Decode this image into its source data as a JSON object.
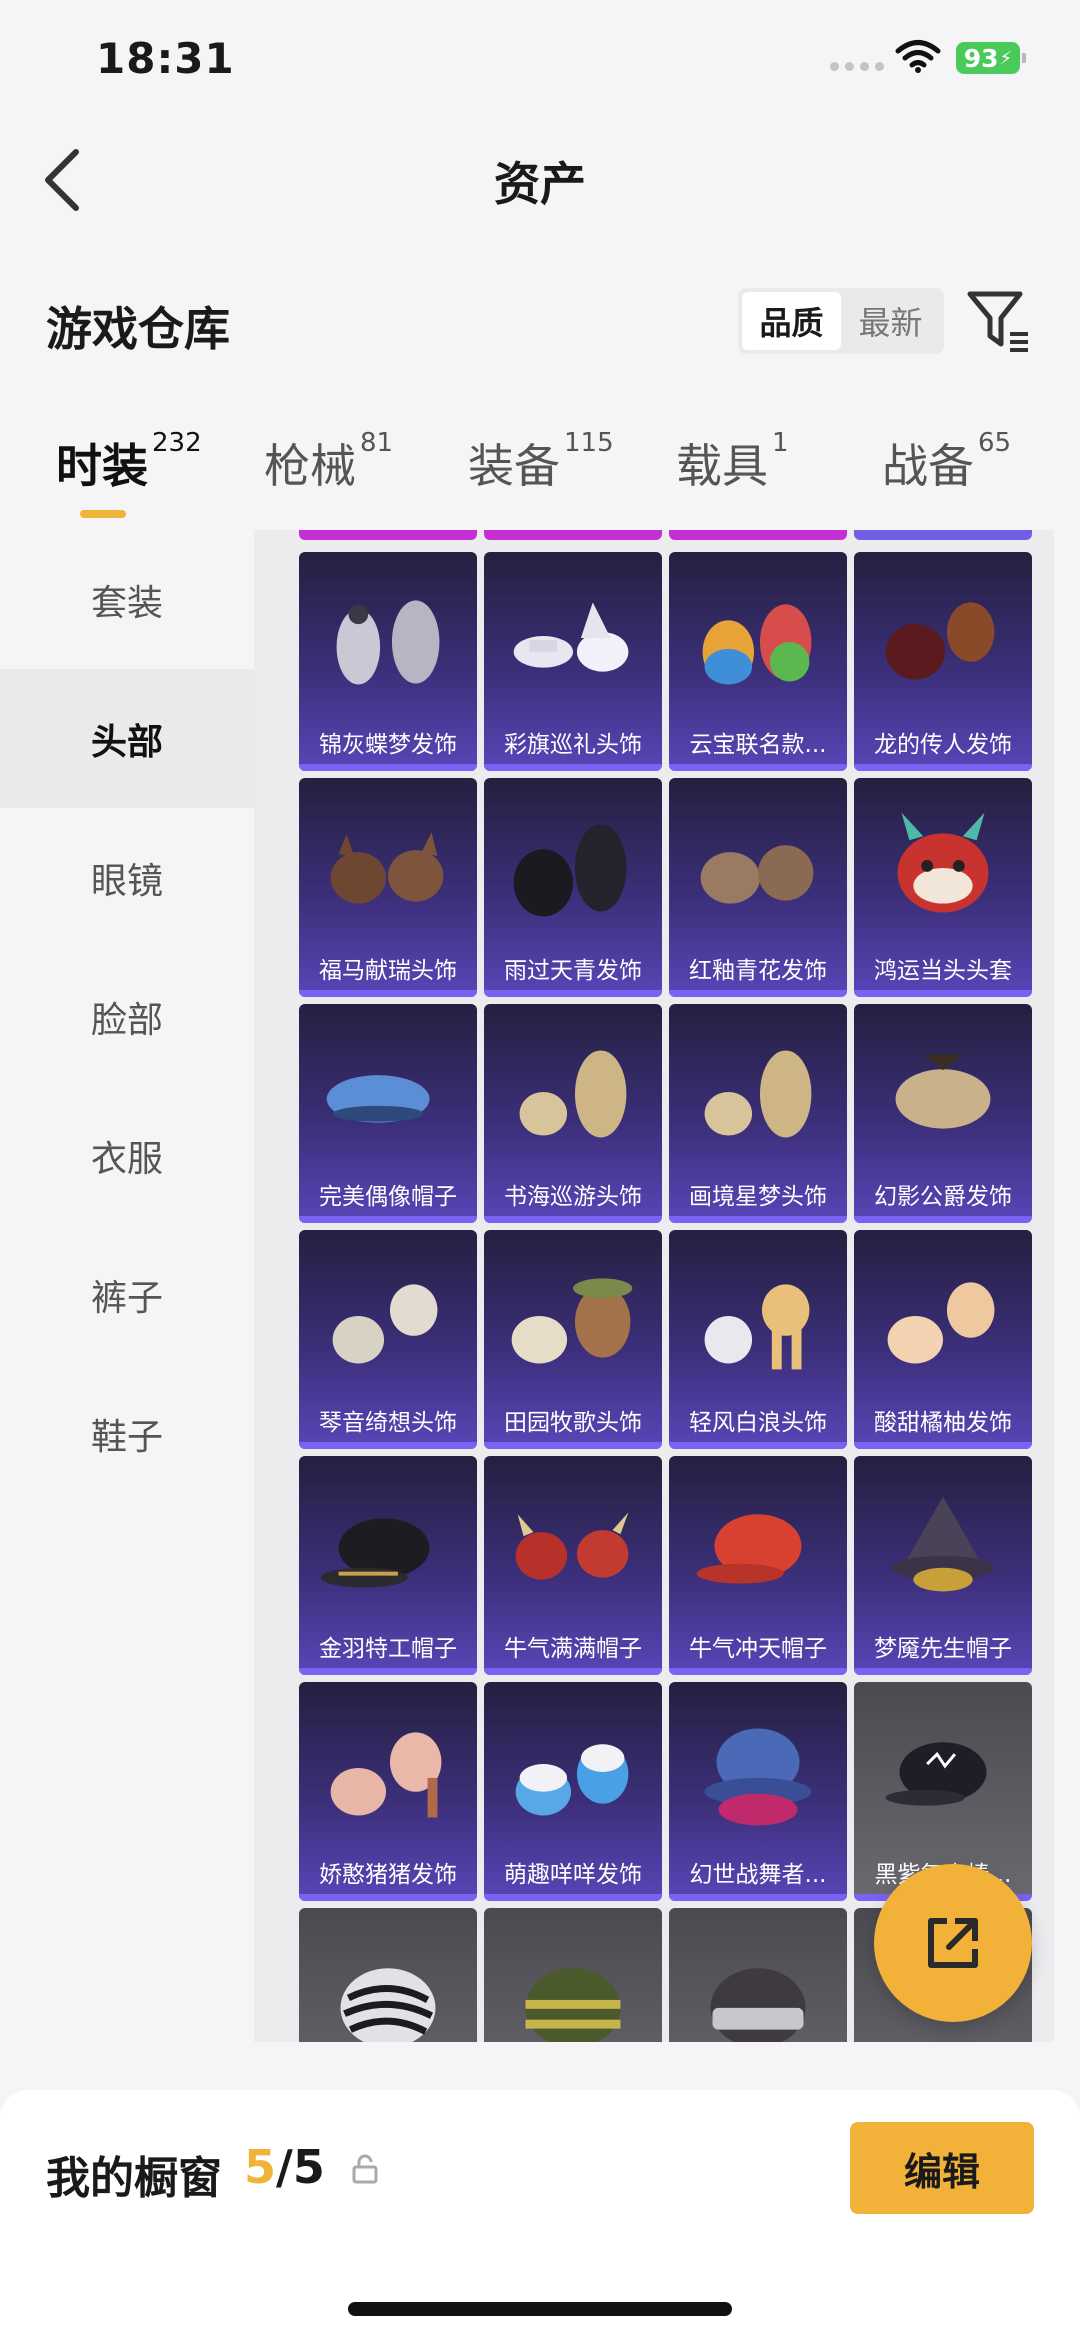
{
  "status_bar": {
    "time": "18:31",
    "battery": "93"
  },
  "nav": {
    "title": "资产"
  },
  "section": {
    "title": "游戏仓库"
  },
  "sort": {
    "options": [
      "品质",
      "最新"
    ],
    "active": "品质"
  },
  "categories": [
    {
      "label": "时装",
      "count": "232",
      "active": true
    },
    {
      "label": "枪械",
      "count": "81"
    },
    {
      "label": "装备",
      "count": "115"
    },
    {
      "label": "载具",
      "count": "1"
    },
    {
      "label": "战备",
      "count": "65"
    }
  ],
  "sidebar": {
    "items": [
      {
        "label": "套装"
      },
      {
        "label": "头部",
        "active": true
      },
      {
        "label": "眼镜"
      },
      {
        "label": "脸部"
      },
      {
        "label": "衣服"
      },
      {
        "label": "裤子"
      },
      {
        "label": "鞋子"
      }
    ]
  },
  "items": [
    {
      "name": "锦灰蝶梦发饰",
      "art": "silver-hair",
      "rarity": "purple"
    },
    {
      "name": "彩旗巡礼头饰",
      "art": "white-hat",
      "rarity": "purple"
    },
    {
      "name": "云宝联名款...",
      "art": "rainbow-hair",
      "rarity": "purple"
    },
    {
      "name": "龙的传人发饰",
      "art": "red-hair",
      "rarity": "purple"
    },
    {
      "name": "福马献瑞头饰",
      "art": "horse-ears",
      "rarity": "purple"
    },
    {
      "name": "雨过天青发饰",
      "art": "black-hair",
      "rarity": "purple"
    },
    {
      "name": "红釉青花发饰",
      "art": "brown-hair",
      "rarity": "purple"
    },
    {
      "name": "鸿运当头头套",
      "art": "lion-mask",
      "rarity": "purple"
    },
    {
      "name": "完美偶像帽子",
      "art": "blue-beret",
      "rarity": "purple"
    },
    {
      "name": "书海巡游头饰",
      "art": "blonde-hair",
      "rarity": "purple"
    },
    {
      "name": "画境星梦头饰",
      "art": "blonde-hair",
      "rarity": "purple"
    },
    {
      "name": "幻影公爵发饰",
      "art": "blonde-bob",
      "rarity": "purple"
    },
    {
      "name": "琴音绮想头饰",
      "art": "platinum-hair",
      "rarity": "purple"
    },
    {
      "name": "田园牧歌头饰",
      "art": "straw-hat",
      "rarity": "purple"
    },
    {
      "name": "轻风白浪头饰",
      "art": "braid-hair",
      "rarity": "purple"
    },
    {
      "name": "酸甜橘柚发饰",
      "art": "peach-hair",
      "rarity": "purple"
    },
    {
      "name": "金羽特工帽子",
      "art": "black-cap",
      "rarity": "purple"
    },
    {
      "name": "牛气满满帽子",
      "art": "ox-hat",
      "rarity": "purple"
    },
    {
      "name": "牛气冲天帽子",
      "art": "red-cap",
      "rarity": "purple"
    },
    {
      "name": "梦魇先生帽子",
      "art": "witch-hat",
      "rarity": "purple"
    },
    {
      "name": "娇憨猪猪发饰",
      "art": "pink-hair",
      "rarity": "purple"
    },
    {
      "name": "萌趣咩咩发饰",
      "art": "sheep-hair",
      "rarity": "purple"
    },
    {
      "name": "幻世战舞者...",
      "art": "bucket-hat",
      "rarity": "purple"
    },
    {
      "name": "黑紫复古棒...",
      "art": "dark-cap",
      "rarity": "gray"
    },
    {
      "name": "",
      "art": "zebra-beanie",
      "rarity": "gray"
    },
    {
      "name": "",
      "art": "green-beanie",
      "rarity": "gray"
    },
    {
      "name": "",
      "art": "gray-beanie",
      "rarity": "gray"
    },
    {
      "name": "",
      "art": "none",
      "rarity": "gray"
    }
  ],
  "showcase": {
    "title": "我的橱窗",
    "current": "5",
    "total": "/5"
  },
  "actions": {
    "edit": "编辑"
  },
  "colors": {
    "accent": "#f2b23a",
    "card_purple": "#3c2f7a",
    "rarity_bar": "#7c62f2"
  }
}
